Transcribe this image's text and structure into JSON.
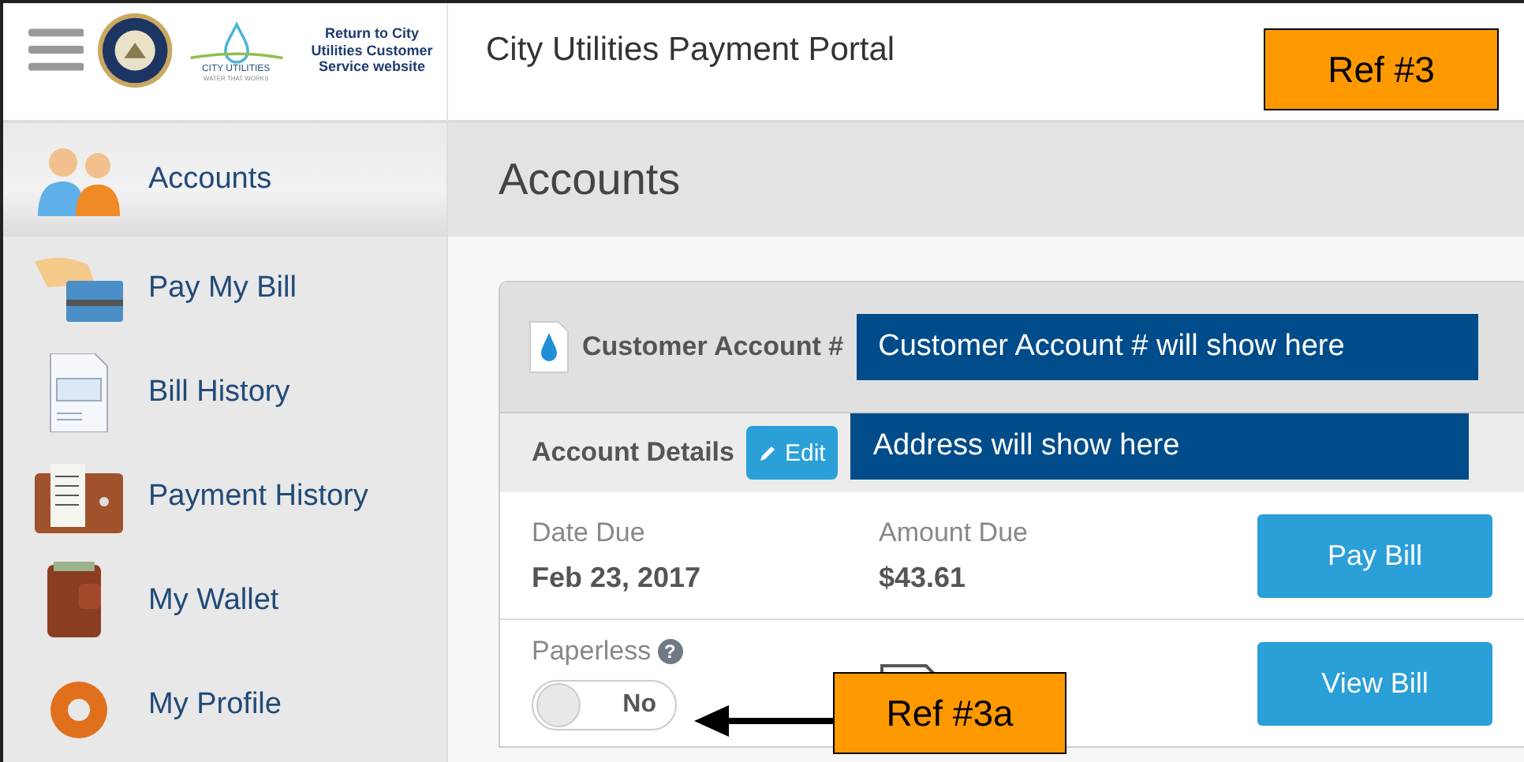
{
  "header": {
    "logo_brand": "CITY UTILITIES",
    "logo_tagline": "WATER THAT WORKS",
    "return_link": "Return to City Utilities Customer Service website",
    "title": "City Utilities Payment Portal"
  },
  "sidebar": {
    "items": [
      {
        "label": "Accounts",
        "kind": "people",
        "selected": true
      },
      {
        "label": "Pay My Bill",
        "kind": "card",
        "selected": false
      },
      {
        "label": "Bill History",
        "kind": "invoice",
        "selected": false
      },
      {
        "label": "Payment History",
        "kind": "receipt",
        "selected": false
      },
      {
        "label": "My Wallet",
        "kind": "wallet",
        "selected": false
      },
      {
        "label": "My Profile",
        "kind": "gear",
        "selected": false
      }
    ]
  },
  "page_title": "Accounts",
  "account": {
    "account_label": "Customer Account #",
    "account_value": "Customer Account # will show here",
    "details_label": "Account Details",
    "edit_button": "Edit",
    "address": "Address will show here",
    "date_due_label": "Date Due",
    "date_due": "Feb 23, 2017",
    "amount_due_label": "Amount Due",
    "amount_due": "$43.61",
    "pay_button": "Pay Bill",
    "paperless_label": "Paperless",
    "help": "?",
    "paperless": {
      "on": false,
      "label": "No"
    },
    "view_button": "View Bill"
  },
  "annotations": [
    {
      "label": "Ref #3"
    },
    {
      "label": "Ref #3a"
    }
  ]
}
